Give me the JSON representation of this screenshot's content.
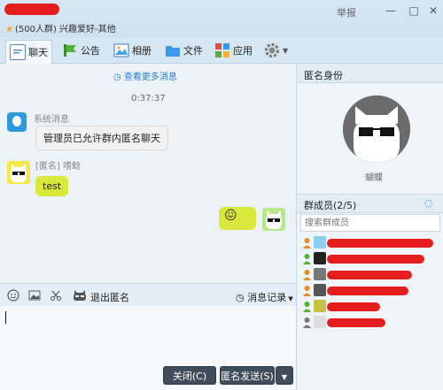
{
  "window": {
    "group_subtitle": "(500人群) 兴趣爱好-其他",
    "report_label": "举报",
    "min_glyph": "—",
    "max_glyph": "□",
    "close_glyph": "✕"
  },
  "toolbar": {
    "items": [
      {
        "label": "聊天",
        "icon": "chat-icon",
        "active": true
      },
      {
        "label": "公告",
        "icon": "announcement-icon"
      },
      {
        "label": "相册",
        "icon": "album-icon"
      },
      {
        "label": "文件",
        "icon": "folder-icon"
      },
      {
        "label": "应用",
        "icon": "apps-icon"
      }
    ]
  },
  "chat": {
    "view_more": "查看更多消息",
    "timestamp": "0:37:37",
    "messages": [
      {
        "sender": "系统消息",
        "text": "管理员已允许群内匿名聊天"
      },
      {
        "sender": "[匿名] 嗜鲶",
        "text": "test"
      }
    ],
    "my_emoji": "😖"
  },
  "input_bar": {
    "exit_anonymous": "退出匿名",
    "message_record": "消息记录"
  },
  "buttons": {
    "close": "关闭(C)",
    "anon_send": "匿名发送(S)"
  },
  "right_panel": {
    "anon_identity_title": "匿名身份",
    "anon_nickname": "蝴蝶",
    "members_title": "群成员(2/5)",
    "search_placeholder": "搜索群成员",
    "members_count": 6
  },
  "colors": {
    "redaction": "#e61d1d",
    "bubble_green": "#d9e83a",
    "link_blue": "#2b7bc8",
    "button_dark": "#404e5c"
  }
}
